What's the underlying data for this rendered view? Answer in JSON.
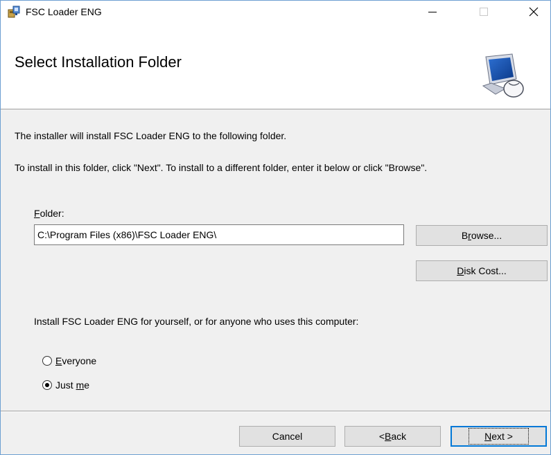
{
  "window": {
    "title": "FSC Loader ENG",
    "controls": {
      "minimize": "–",
      "maximize": "☐",
      "close": "✕"
    }
  },
  "banner": {
    "title": "Select Installation Folder",
    "icon": "computer-mouse-icon"
  },
  "body": {
    "intro_line1": "The installer will install FSC Loader ENG to the following folder.",
    "intro_line2": "To install in this folder, click \"Next\". To install to a different folder, enter it below or click \"Browse\".",
    "folder_label_accel": "F",
    "folder_label_rest": "older:",
    "folder_value": "C:\\Program Files (x86)\\FSC Loader ENG\\",
    "browse_pre": "B",
    "browse_accel": "r",
    "browse_post": "owse...",
    "disk_cost_accel": "D",
    "disk_cost_rest": "isk Cost...",
    "scope_prompt": "Install FSC Loader ENG for yourself, or for anyone who uses this computer:",
    "everyone_accel": "E",
    "everyone_rest": "veryone",
    "justme_pre": "Just ",
    "justme_accel": "m",
    "justme_post": "e",
    "selected_scope": "Just me"
  },
  "footer": {
    "cancel": "Cancel",
    "back_pre": "< ",
    "back_accel": "B",
    "back_post": "ack",
    "next_accel": "N",
    "next_post": "ext >"
  }
}
